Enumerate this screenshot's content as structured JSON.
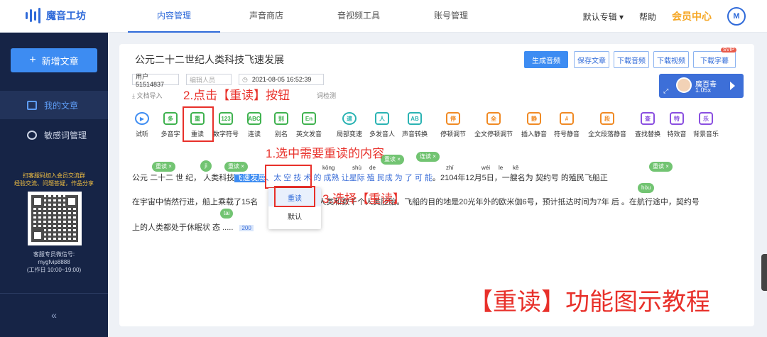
{
  "app": {
    "name": "魔音工坊"
  },
  "nav": {
    "items": [
      "内容管理",
      "声音商店",
      "音视频工具",
      "账号管理"
    ],
    "album": "默认专辑",
    "help": "帮助",
    "member": "会员中心",
    "avatar": "M"
  },
  "sidebar": {
    "new_article": "新增文章",
    "items": [
      "我的文章",
      "敏感词管理"
    ],
    "qr_note": [
      "扫客服码加入会员交流群",
      "经验交流、问题答疑，作品分享"
    ],
    "service": [
      "客服专员微信号:",
      "mygfvip8888",
      "(工作日 10:00~19:00)"
    ],
    "collapse": "«"
  },
  "doc": {
    "title": "公元二十二世纪人类科技飞速发展",
    "user": "用户51514837",
    "editor_placeholder": "编辑人员",
    "datetime": "2021-08-05 16:52:39",
    "import": "文档导入",
    "check": "词检测"
  },
  "actions": {
    "generate": "生成音频",
    "save": "保存文章",
    "download_audio": "下载音频",
    "download_video": "下载视频",
    "download_subtitle": "下载字幕",
    "svip": "SVIP"
  },
  "voice": {
    "name": "魔百毒",
    "speed": "1.05x"
  },
  "toolbar": [
    {
      "label": "试听",
      "icon": "▶"
    },
    {
      "label": "多音字",
      "icon": "多"
    },
    {
      "label": "重读",
      "icon": "重"
    },
    {
      "label": "数字符号",
      "icon": "123"
    },
    {
      "label": "连读",
      "icon": "ABC"
    },
    {
      "label": "别名",
      "icon": "别"
    },
    {
      "label": "英文发音",
      "icon": "En"
    },
    {
      "label": "局部变速",
      "icon": "速"
    },
    {
      "label": "多发音人",
      "icon": "人"
    },
    {
      "label": "声音转换",
      "icon": "AB"
    },
    {
      "label": "停顿调节",
      "icon": "停"
    },
    {
      "label": "全文停顿调节",
      "icon": "全"
    },
    {
      "label": "插入静音",
      "icon": "静"
    },
    {
      "label": "符号静音",
      "icon": "#"
    },
    {
      "label": "全文段落静音",
      "icon": "段"
    },
    {
      "label": "查找替换",
      "icon": "查"
    },
    {
      "label": "特效音",
      "icon": "特"
    },
    {
      "label": "背景音乐",
      "icon": "乐"
    }
  ],
  "annotations": {
    "step1": "1.选中需要重读的内容",
    "step2": "2.点击【重读】按钮",
    "step3": "3.选择【重读】",
    "title": "【重读】功能图示教程"
  },
  "content": {
    "line1_a": "公元",
    "line1_b": "二十二",
    "line1_c": "世 纪，",
    "line1_d": "人类",
    "line1_e": "科技",
    "line1_sel": "飞速发展",
    "line1_f": "、太 空 技 术 的",
    "line1_g": "成熟",
    "line1_h": "让星际 殖 民成 为 了 可 能",
    "line1_i": "。2104年12月5日，一艘名为",
    "line1_j": "契约号",
    "line1_k": "的殖民飞船正",
    "line2_a": "在宇宙中悄然行进，船上乘载了15名",
    "line2_b": "人类和数千个人类胚胎。飞船的目的地是20光年外的欧米伽6号，预计抵达时间为7年 后 。在航行途中，契约号",
    "line3_a": "上的人类都处于休眠状 态 .....",
    "line3_b": "200",
    "tags": {
      "reread": "重读 ×",
      "liandu": "连读 ×",
      "ji": "ji",
      "hou": "hòu",
      "tai": "tai"
    },
    "pinyin": {
      "kong": "kōng",
      "shu": "shù",
      "de": "de",
      "zhi": "zhí",
      "wei": "wéi",
      "le": "le",
      "ke": "kě"
    }
  },
  "popup": {
    "options": [
      "重读",
      "默认"
    ]
  }
}
